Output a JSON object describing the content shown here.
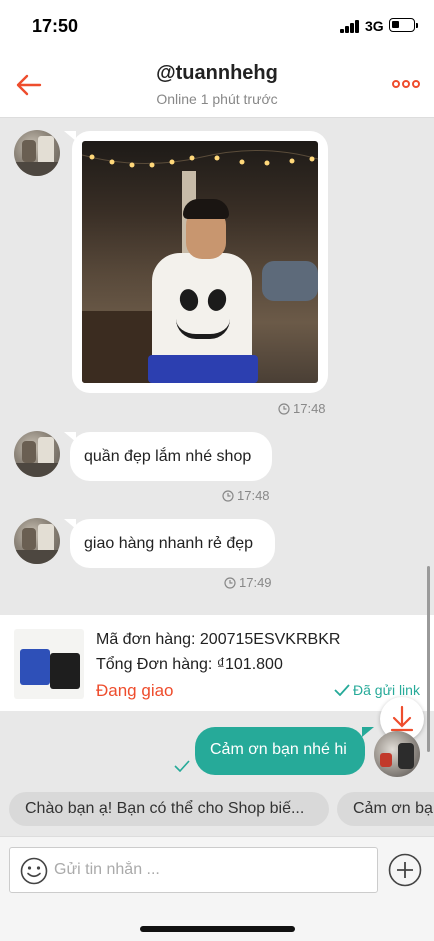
{
  "status_bar": {
    "time": "17:50",
    "network": "3G"
  },
  "header": {
    "title": "@tuannhehg",
    "subtitle": "Online 1 phút trước",
    "back_icon": "arrow-left-icon",
    "more_icon": "more-dots-icon"
  },
  "messages": [
    {
      "type": "image",
      "time": "17:48"
    },
    {
      "type": "text",
      "text": "quần đẹp lắm nhé shop",
      "time": "17:48"
    },
    {
      "type": "text",
      "text": "giao hàng nhanh rẻ đẹp",
      "time": "17:49"
    }
  ],
  "order": {
    "code_line": "Mã đơn hàng: 200715ESVKRBKR",
    "total_line": "Tổng Đơn hàng: ₫101.800",
    "status": "Đang giao",
    "sent_label": "Đã gửi link"
  },
  "my_message": {
    "text": "Cảm ơn bạn nhé hi"
  },
  "quick_replies": [
    "Chào bạn ạ! Bạn có thể cho Shop biế...",
    "Cảm ơn bạ"
  ],
  "input": {
    "placeholder": "Gửi tin nhắn ..."
  },
  "colors": {
    "accent": "#ee4d2d",
    "teal": "#26aa99",
    "chat_bg": "#e8e8e8"
  }
}
